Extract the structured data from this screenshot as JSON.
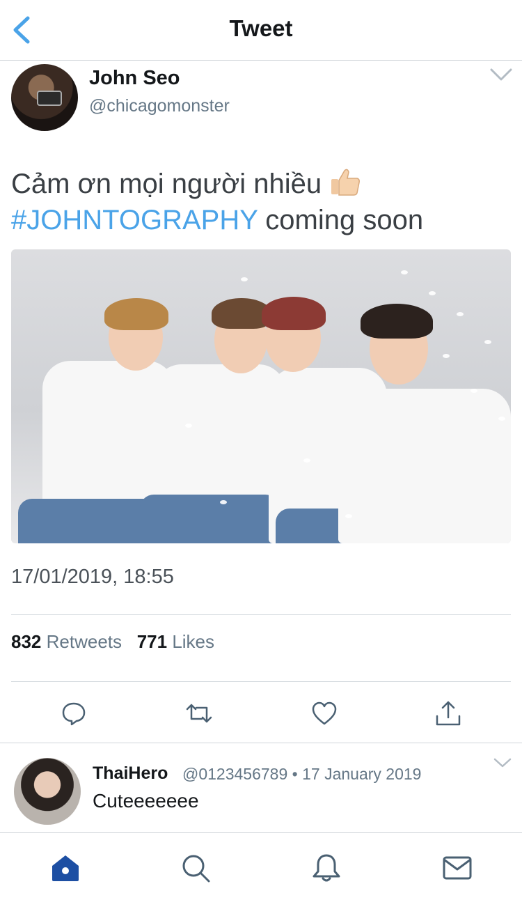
{
  "header": {
    "title": "Tweet",
    "back_icon": "chevron-left-icon"
  },
  "tweet": {
    "author_name": "John Seo",
    "author_handle": "@chicagomonster",
    "text_line1": "Cảm ơn mọi người nhiều",
    "emoji": "thumbs-up-icon",
    "hashtag": "#JOHNTOGRAPHY",
    "text_line2_rest": " coming soon",
    "timestamp": "17/01/2019, 18:55",
    "retweets_count": "832",
    "retweets_label": "Retweets",
    "likes_count": "771",
    "likes_label": "Likes"
  },
  "actions": [
    "reply-icon",
    "retweet-icon",
    "like-icon",
    "share-icon"
  ],
  "reply": {
    "name": "ThaiHero",
    "meta": "@0123456789 • 17 January 2019",
    "text": "Cuteeeeeee"
  },
  "tabs": [
    "home-icon",
    "search-icon",
    "notifications-icon",
    "messages-icon"
  ],
  "colors": {
    "accent": "#4aa3e8",
    "home_active": "#1d4fa3",
    "icon": "#4a6072"
  }
}
